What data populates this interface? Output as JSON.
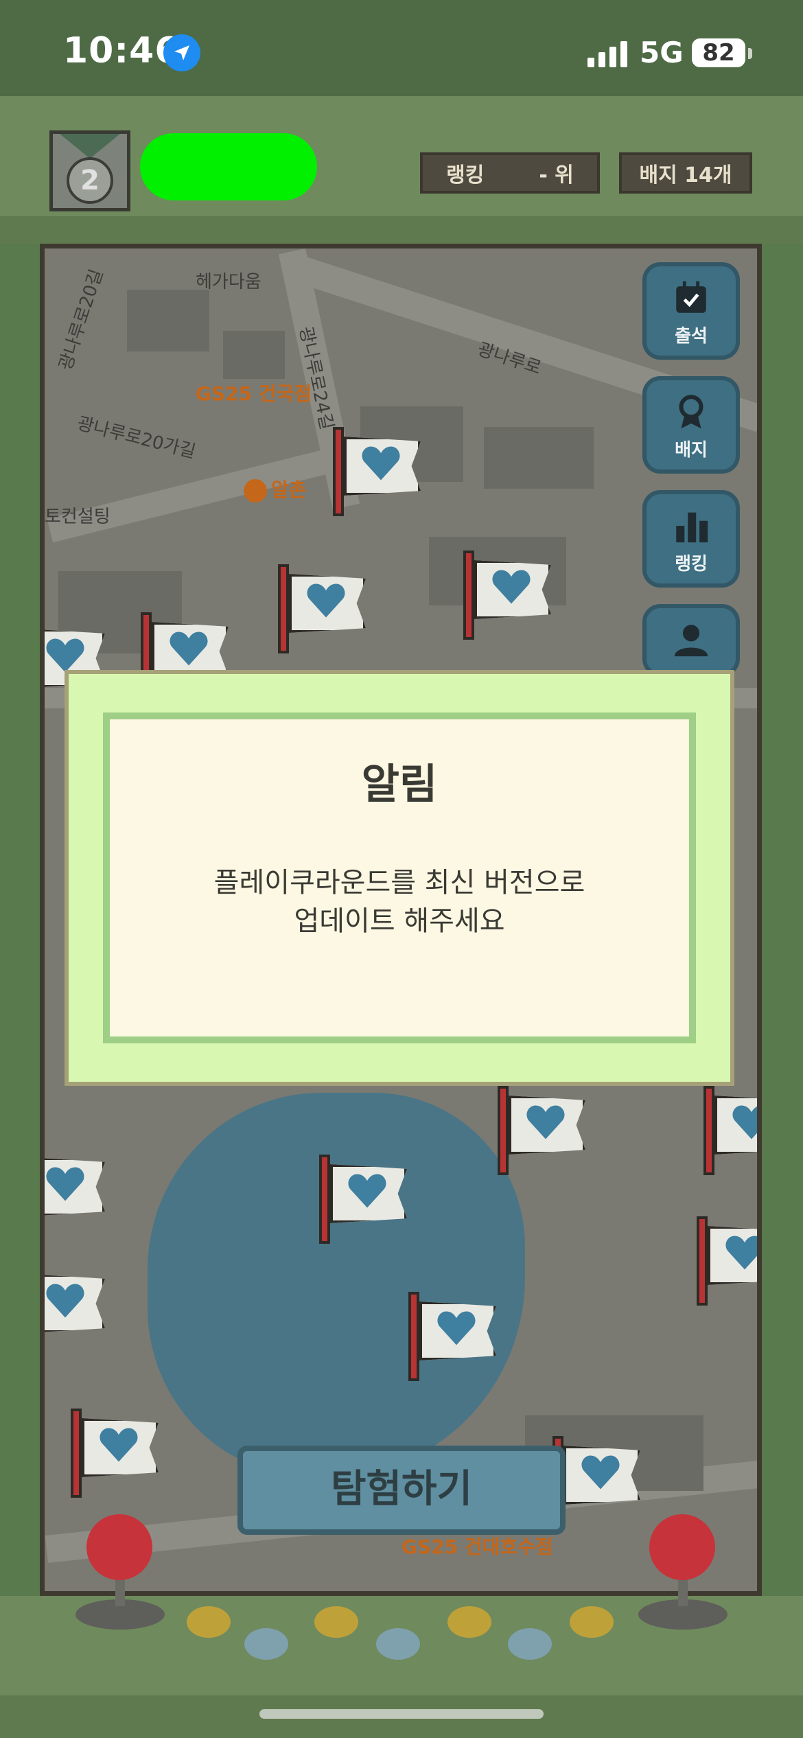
{
  "status_bar": {
    "time": "10:46",
    "network": "5G",
    "battery": "82"
  },
  "header": {
    "rank_label": "랭킹",
    "rank_value": "- 위",
    "badge_count": "배지 14개"
  },
  "map": {
    "labels": [
      "헤가다움",
      "광나루로24길",
      "광나루로",
      "광나루로20길",
      "GS25 건국점",
      "광나루로20가길",
      "알촌",
      "토컨설팅",
      "GS25 건대호수점"
    ]
  },
  "side_menu": [
    {
      "label": "출석",
      "icon": "calendar-check-icon"
    },
    {
      "label": "배지",
      "icon": "ribbon-badge-icon"
    },
    {
      "label": "랭킹",
      "icon": "ranking-bars-icon"
    },
    {
      "label": "",
      "icon": "person-icon"
    }
  ],
  "modal": {
    "title": "알림",
    "line1": "플레이쿠라운드를 최신 버전으로",
    "line2": "업데이트 해주세요"
  },
  "explore_button": "탐험하기",
  "colors": {
    "modal_outer": "#d8f7b0",
    "modal_inner": "#fdf8e3",
    "frame": "#6f8a5d",
    "menu_button": "#3f6f82",
    "nickname_redaction": "#00f000"
  }
}
